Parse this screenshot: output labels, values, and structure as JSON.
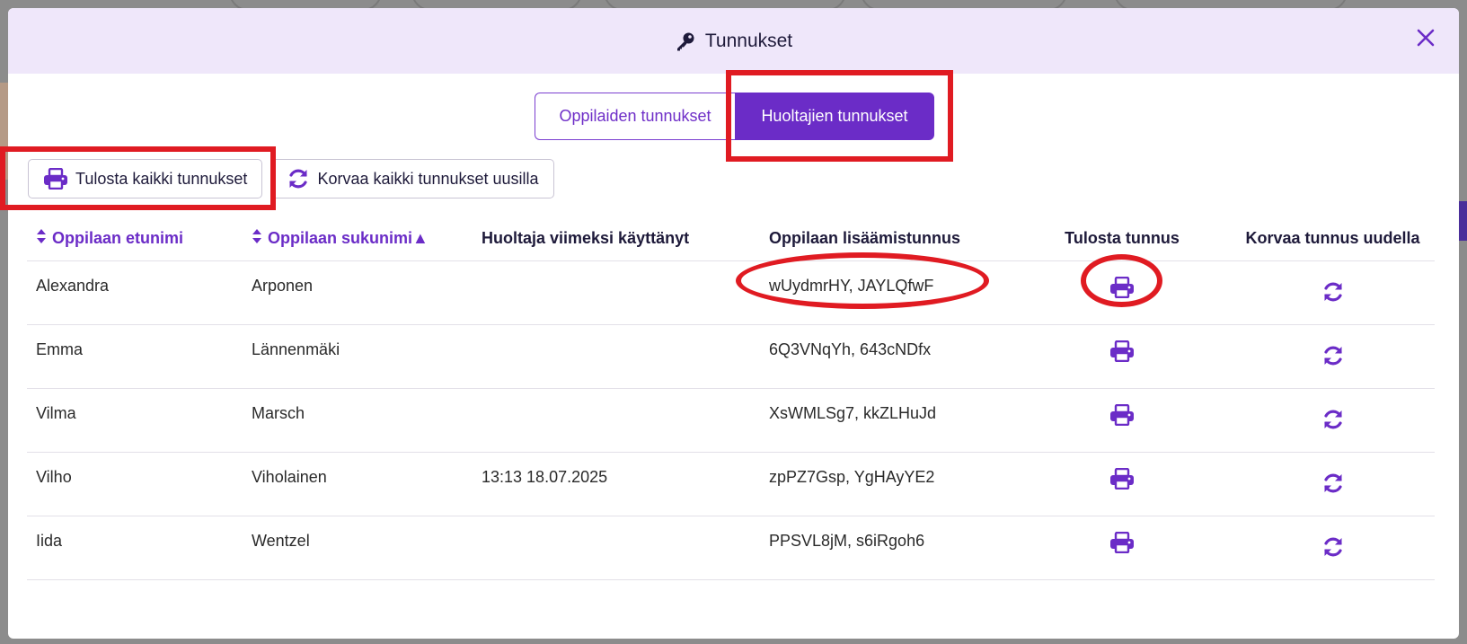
{
  "modal": {
    "title": "Tunnukset",
    "title_icon": "key-icon",
    "close_icon": "close-icon"
  },
  "tabs": [
    {
      "label": "Oppilaiden tunnukset",
      "active": false
    },
    {
      "label": "Huoltajien tunnukset",
      "active": true
    }
  ],
  "actions": {
    "print_all_label": "Tulosta kaikki tunnukset",
    "print_all_icon": "printer-icon",
    "replace_all_label": "Korvaa kaikki tunnukset uusilla",
    "replace_all_icon": "refresh-icon"
  },
  "table": {
    "columns": [
      "Oppilaan etunimi",
      "Oppilaan sukunimi▲",
      "Huoltaja viimeksi käyttänyt",
      "Oppilaan lisäämistunnus",
      "Tulosta tunnus",
      "Korvaa tunnus uudella"
    ],
    "rows": [
      {
        "first": "Alexandra",
        "last": "Arponen",
        "last_used": "",
        "code": "wUydmrHY, JAYLQfwF"
      },
      {
        "first": "Emma",
        "last": "Lännenmäki",
        "last_used": "",
        "code": "6Q3VNqYh, 643cNDfx"
      },
      {
        "first": "Vilma",
        "last": "Marsch",
        "last_used": "",
        "code": "XsWMLSg7, kkZLHuJd"
      },
      {
        "first": "Vilho",
        "last": "Viholainen",
        "last_used": "13:13 18.07.2025",
        "code": "zpPZ7Gsp, YgHAyYE2"
      },
      {
        "first": "Iida",
        "last": "Wentzel",
        "last_used": "",
        "code": "PPSVL8jM, s6iRgoh6"
      }
    ]
  },
  "colors": {
    "accent": "#6b2cc7",
    "header_bg": "#efe7fa",
    "annotation": "#e01b22"
  }
}
